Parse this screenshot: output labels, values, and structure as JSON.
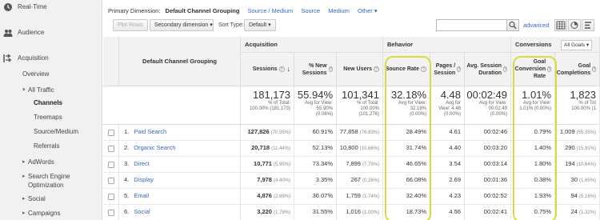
{
  "sidebar": {
    "items": [
      {
        "label": "Real-Time",
        "icon": "clock-icon"
      },
      {
        "label": "Audience",
        "icon": "people-icon"
      },
      {
        "label": "Acquisition",
        "icon": "acquisition-icon"
      },
      {
        "label": "Overview"
      },
      {
        "label": "All Traffic"
      },
      {
        "label": "Channels"
      },
      {
        "label": "Treemaps"
      },
      {
        "label": "Source/Medium"
      },
      {
        "label": "Referrals"
      },
      {
        "label": "AdWords"
      },
      {
        "label": "Search Engine Optimization"
      },
      {
        "label": "Social"
      },
      {
        "label": "Campaigns"
      }
    ]
  },
  "primary_dimension": {
    "label": "Primary Dimension:",
    "active": "Default Channel Grouping",
    "links": [
      "Source / Medium",
      "Source",
      "Medium"
    ],
    "other": "Other"
  },
  "toolbar": {
    "plot_rows": "Plot Rows",
    "secondary_dimension": "Secondary dimension",
    "sort_type_label": "Sort Type:",
    "sort_type_value": "Default",
    "advanced": "advanced"
  },
  "table": {
    "groups": {
      "acquisition": "Acquisition",
      "behavior": "Behavior",
      "conversions": "Conversions",
      "goal_select": "All Goals"
    },
    "dimension_header": "Default Channel Grouping",
    "columns": {
      "sessions": "Sessions",
      "new_sessions": "% New Sessions",
      "new_users": "New Users",
      "bounce_rate": "Bounce Rate",
      "pages_session": "Pages / Session",
      "avg_duration": "Avg. Session Duration",
      "goal_conv_rate": "Goal Conversion Rate",
      "goal_completions": "Goal Completions"
    },
    "totals": {
      "sessions": {
        "big": "181,173",
        "sub1": "% of Total:",
        "sub2": "100.00% (181,173)"
      },
      "new_sessions": {
        "big": "55.94%",
        "sub1": "Avg for View:",
        "sub2": "55.90%",
        "sub3": "(0.06%)"
      },
      "new_users": {
        "big": "101,341",
        "sub1": "% of Total:",
        "sub2": "100.00%",
        "sub3": "(101,276)"
      },
      "bounce_rate": {
        "big": "32.18%",
        "sub1": "Avg for View:",
        "sub2": "32.18%",
        "sub3": "(0.00%)"
      },
      "pages_session": {
        "big": "4.48",
        "sub1": "Avg for",
        "sub2": "View: 4.48",
        "sub3": "(0.00%)"
      },
      "avg_duration": {
        "big": "00:02:49",
        "sub1": "Avg for View:",
        "sub2": "00:02:49",
        "sub3": "(0.00%)"
      },
      "goal_conv_rate": {
        "big": "1.01%",
        "sub1": "Avg for View:",
        "sub2": "1.01% (0.00%)"
      },
      "goal_completions": {
        "big": "1,823",
        "sub1": "% of Tot",
        "sub2": "100.00% (1"
      }
    },
    "rows": [
      {
        "num": "1.",
        "name": "Paid Search",
        "sessions": "127,826",
        "sessions_pct": "(70.55%)",
        "new_sessions": "60.91%",
        "new_users": "77,858",
        "new_users_pct": "(76.83%)",
        "bounce_rate": "28.49%",
        "pages": "4.61",
        "duration": "00:02:46",
        "conv_rate": "0.79%",
        "completions": "1,009",
        "completions_pct": "(55.35%)"
      },
      {
        "num": "2.",
        "name": "Organic Search",
        "sessions": "20,718",
        "sessions_pct": "(11.44%)",
        "new_sessions": "52.13%",
        "new_users": "10,800",
        "new_users_pct": "(10.66%)",
        "bounce_rate": "31.74%",
        "pages": "4.40",
        "duration": "00:03:20",
        "conv_rate": "1.40%",
        "completions": "290",
        "completions_pct": "(15.91%)"
      },
      {
        "num": "3.",
        "name": "Direct",
        "sessions": "10,771",
        "sessions_pct": "(5.95%)",
        "new_sessions": "73.34%",
        "new_users": "7,899",
        "new_users_pct": "(7.79%)",
        "bounce_rate": "46.65%",
        "pages": "3.54",
        "duration": "00:03:14",
        "conv_rate": "1.80%",
        "completions": "194",
        "completions_pct": "(10.64%)"
      },
      {
        "num": "4.",
        "name": "Display",
        "sessions": "7,978",
        "sessions_pct": "(4.40%)",
        "new_sessions": "3.35%",
        "new_users": "267",
        "new_users_pct": "(0.26%)",
        "bounce_rate": "66.08%",
        "pages": "2.69",
        "duration": "00:01:36",
        "conv_rate": "0.38%",
        "completions": "30",
        "completions_pct": "(1.65%)"
      },
      {
        "num": "5.",
        "name": "Email",
        "sessions": "4,876",
        "sessions_pct": "(2.69%)",
        "new_sessions": "36.07%",
        "new_users": "1,759",
        "new_users_pct": "(1.74%)",
        "bounce_rate": "32.40%",
        "pages": "4.23",
        "duration": "00:02:52",
        "conv_rate": "1.93%",
        "completions": "94",
        "completions_pct": "(5.16%)"
      },
      {
        "num": "6.",
        "name": "Social",
        "sessions": "3,220",
        "sessions_pct": "(1.78%)",
        "new_sessions": "31.55%",
        "new_users": "1,016",
        "new_users_pct": "(1.00%)",
        "bounce_rate": "18.73%",
        "pages": "4.56",
        "duration": "00:02:41",
        "conv_rate": "0.75%",
        "completions": "24",
        "completions_pct": "(1.32%)"
      }
    ]
  },
  "colors": {
    "highlight": "#d8dc3a",
    "link": "#3366cc",
    "sidebar_bg": "#f1f1f1",
    "header_bg": "#f2f2f2"
  }
}
